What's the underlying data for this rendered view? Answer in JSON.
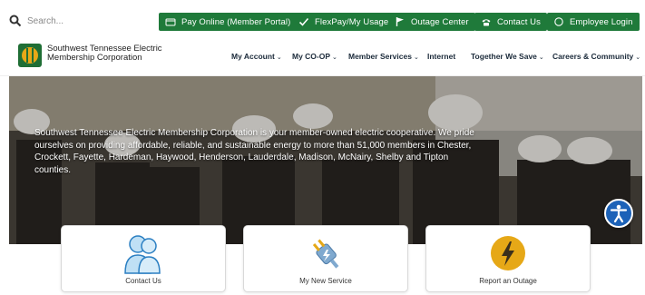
{
  "search": {
    "placeholder": "Search..."
  },
  "top_buttons": [
    {
      "label": "Pay Online (Member Portal)",
      "icon": "credit-card-icon"
    },
    {
      "label": "FlexPay/My Usage",
      "icon": "checkmark-icon"
    },
    {
      "label": "Outage Center",
      "icon": "flag-icon"
    },
    {
      "label": "Contact Us",
      "icon": "phone-icon"
    },
    {
      "label": "Employee Login",
      "icon": "circle-icon"
    }
  ],
  "logo": {
    "line1": "Southwest Tennessee Electric",
    "line2": "Membership Corporation"
  },
  "nav": [
    {
      "label": "My Account",
      "dropdown": true
    },
    {
      "label": "My CO-OP",
      "dropdown": true
    },
    {
      "label": "Member Services",
      "dropdown": true
    },
    {
      "label": "Internet",
      "dropdown": false
    },
    {
      "label": "Together We Save",
      "dropdown": true
    },
    {
      "label": "Careers & Community",
      "dropdown": true
    }
  ],
  "hero": {
    "text": "Southwest Tennessee Electric Membership Corporation is your member-owned electric cooperative. We pride ourselves on providing affordable, reliable, and sustainable energy to more than 51,000 members in Chester, Crockett, Fayette, Hardeman, Haywood, Henderson, Lauderdale, Madison, McNairy, Shelby and Tipton counties."
  },
  "cards": [
    {
      "label": "Contact Us",
      "icon": "people-icon"
    },
    {
      "label": "My New Service",
      "icon": "plug-icon"
    },
    {
      "label": "Report an Outage",
      "icon": "lightning-icon"
    }
  ],
  "colors": {
    "brand_green": "#1f7a3a",
    "accessibility_blue": "#1c62b8",
    "lightning_yellow": "#e6a817"
  }
}
